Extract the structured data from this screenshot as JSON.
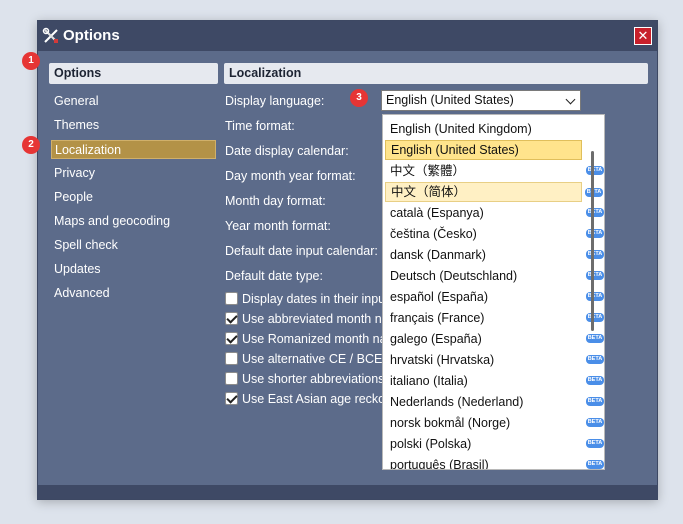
{
  "window": {
    "title": "Options",
    "close_label": "✕"
  },
  "badges": [
    "1",
    "2",
    "3"
  ],
  "sidebar": {
    "header": "Options",
    "items": [
      {
        "label": "General"
      },
      {
        "label": "Themes"
      },
      {
        "label": "Localization",
        "active": true
      },
      {
        "label": "Privacy"
      },
      {
        "label": "People"
      },
      {
        "label": "Maps and geocoding"
      },
      {
        "label": "Spell check"
      },
      {
        "label": "Updates"
      },
      {
        "label": "Advanced"
      }
    ]
  },
  "main": {
    "header": "Localization",
    "fields": [
      "Display language:",
      "Time format:",
      "Date display calendar:",
      "Day month year format:",
      "Month day format:",
      "Year month format:",
      "Default date input calendar:",
      "Default date type:"
    ],
    "checkboxes": [
      {
        "label": "Display dates in their input",
        "checked": false
      },
      {
        "label": "Use abbreviated month na",
        "checked": true
      },
      {
        "label": "Use Romanized month nar",
        "checked": true
      },
      {
        "label": "Use alternative CE / BCE e",
        "checked": false
      },
      {
        "label": "Use shorter abbreviations",
        "checked": false
      },
      {
        "label": "Use East Asian age reckon",
        "checked": true
      }
    ],
    "display_language": {
      "value": "English (United States)",
      "beta_label": "BETA",
      "options": [
        {
          "label": "English (United Kingdom)",
          "beta": false
        },
        {
          "label": "English (United States)",
          "beta": false,
          "selected": true
        },
        {
          "label": "中文（繁體）",
          "beta": true
        },
        {
          "label": "中文（简体）",
          "beta": true,
          "hovered": true
        },
        {
          "label": "català (Espanya)",
          "beta": true
        },
        {
          "label": "čeština (Česko)",
          "beta": true
        },
        {
          "label": "dansk (Danmark)",
          "beta": true
        },
        {
          "label": "Deutsch (Deutschland)",
          "beta": true
        },
        {
          "label": "español (España)",
          "beta": true
        },
        {
          "label": "français (France)",
          "beta": true
        },
        {
          "label": "galego (España)",
          "beta": true
        },
        {
          "label": "hrvatski (Hrvatska)",
          "beta": true
        },
        {
          "label": "italiano (Italia)",
          "beta": true
        },
        {
          "label": "Nederlands (Nederland)",
          "beta": true
        },
        {
          "label": "norsk bokmål (Norge)",
          "beta": true
        },
        {
          "label": "polski (Polska)",
          "beta": true
        },
        {
          "label": "português (Brasil)",
          "beta": true
        }
      ]
    }
  },
  "colors": {
    "window_bg": "#5c6b8a",
    "titlebar_bg": "#3e4965",
    "active_nav": "#b39247",
    "selected_option": "#ffe48c",
    "badge": "#e63535",
    "beta_badge": "#4a8ee8"
  }
}
